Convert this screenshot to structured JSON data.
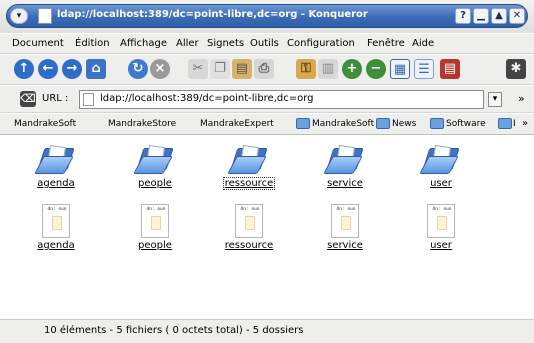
{
  "window": {
    "title": "ldap://localhost:389/dc=point-libre,dc=org - Konqueror",
    "buttons": {
      "help": "?",
      "minimize": "▁",
      "maximize": "▲",
      "close": "✕"
    }
  },
  "menubar": {
    "items": [
      "Document",
      "Édition",
      "Affichage",
      "Aller",
      "Signets",
      "Outils",
      "Configuration",
      "Fenêtre",
      "Aide"
    ]
  },
  "toolbar": {
    "icons": [
      "up-arrow-icon",
      "back-icon",
      "forward-icon",
      "home-icon",
      "reload-icon",
      "stop-icon",
      "cut-icon",
      "copy-icon",
      "paste-icon",
      "print-icon",
      "permissions-icon",
      "sidebar-icon",
      "zoom-in-icon",
      "zoom-out-icon",
      "icon-view-icon",
      "detail-view-icon",
      "firewall-icon",
      "activity-icon"
    ]
  },
  "urlbar": {
    "label": "URL :",
    "value": "ldap://localhost:389/dc=point-libre,dc=org",
    "overflow": "»"
  },
  "bookmarks": {
    "items": [
      "MandrakeSoft",
      "MandrakeStore",
      "MandrakeExpert",
      "MandrakeSoft",
      "News",
      "Software",
      "I"
    ],
    "overflow": "»"
  },
  "folders": [
    {
      "name": "agenda"
    },
    {
      "name": "people"
    },
    {
      "name": "ressource"
    },
    {
      "name": "service"
    },
    {
      "name": "user"
    }
  ],
  "files": [
    {
      "name": "agenda",
      "header": "dn: oun"
    },
    {
      "name": "people",
      "header": "dn: oun"
    },
    {
      "name": "ressource",
      "header": "dn: oun"
    },
    {
      "name": "service",
      "header": "dn: oun"
    },
    {
      "name": "user",
      "header": "dn: oun"
    }
  ],
  "status": {
    "text": "10 éléments - 5 fichiers ( 0 octets total) - 5 dossiers"
  },
  "colors": {
    "title_bar": "#3a6cb7",
    "folder_blue": "#5a95e2",
    "chrome": "#eeeeec"
  }
}
